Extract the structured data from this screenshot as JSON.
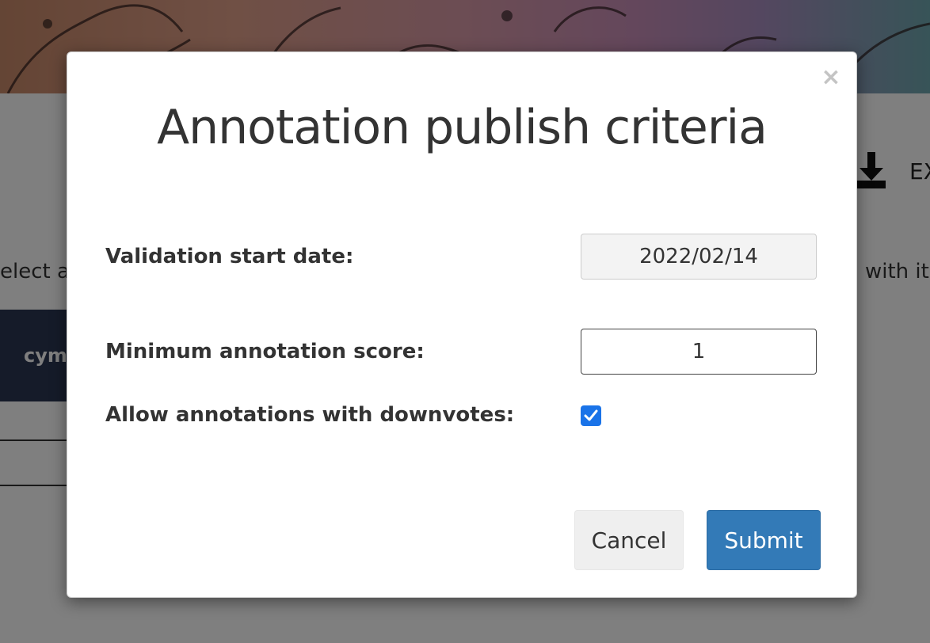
{
  "background": {
    "export_label": "EX",
    "left_text": "elect a",
    "right_text": "with it",
    "tag_label": "cym"
  },
  "modal": {
    "title": "Annotation publish criteria",
    "close_symbol": "×",
    "fields": {
      "validation_start_date": {
        "label": "Validation start date:",
        "value": "2022/02/14"
      },
      "minimum_score": {
        "label": "Minimum annotation score:",
        "value": "1"
      },
      "allow_downvotes": {
        "label": "Allow annotations with downvotes:",
        "checked": true
      }
    },
    "buttons": {
      "cancel": "Cancel",
      "submit": "Submit"
    }
  },
  "colors": {
    "submit": "#337ab7",
    "checkbox": "#1a73e8",
    "overlay": "rgba(0,0,0,0.5)"
  },
  "icons": [
    "download-icon",
    "close-icon",
    "checkmark-icon"
  ]
}
